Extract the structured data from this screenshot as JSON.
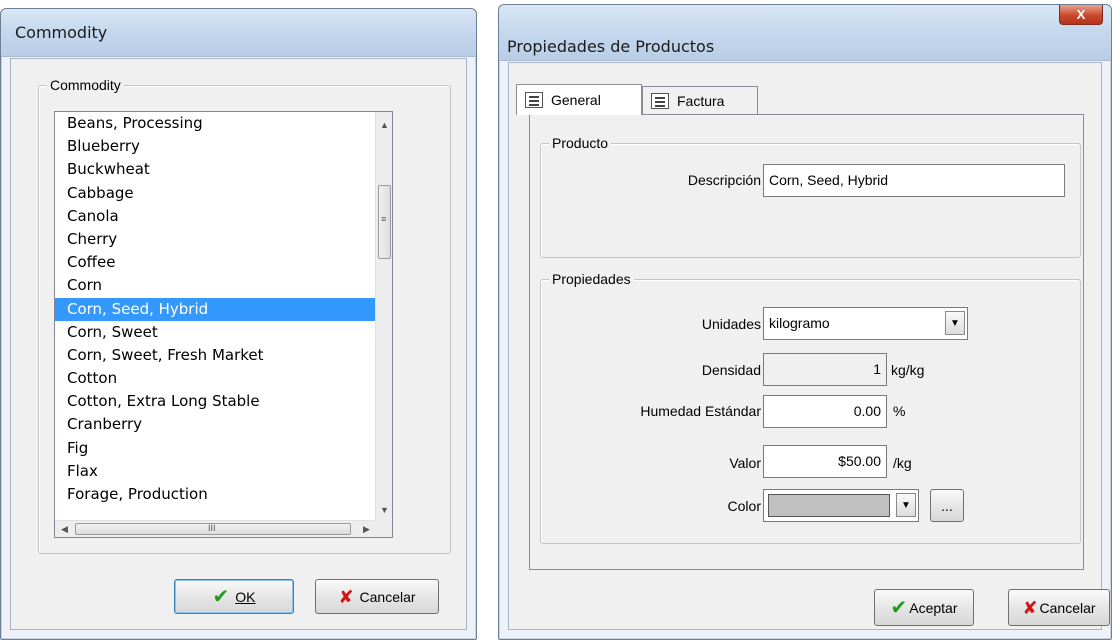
{
  "commodity_dialog": {
    "title": "Commodity",
    "group_label": "Commodity",
    "items": [
      "Beans, Processing",
      "Blueberry",
      "Buckwheat",
      "Cabbage",
      "Canola",
      "Cherry",
      "Coffee",
      "Corn",
      "Corn, Seed, Hybrid",
      "Corn, Sweet",
      "Corn, Sweet, Fresh Market",
      "Cotton",
      "Cotton, Extra Long Stable",
      "Cranberry",
      "Fig",
      "Flax",
      "Forage, Production"
    ],
    "selected_item": "Corn, Seed, Hybrid",
    "ok_label": "OK",
    "cancel_label": "Cancelar"
  },
  "product_dialog": {
    "title": "Propiedades de Productos",
    "close_label": "X",
    "tabs": [
      {
        "label": "General",
        "icon": "properties-icon",
        "active": true
      },
      {
        "label": "Factura",
        "icon": "invoice-icon",
        "active": false
      }
    ],
    "producto_group": {
      "label": "Producto",
      "descripcion_label": "Descripción",
      "descripcion_value": "Corn, Seed, Hybrid"
    },
    "propiedades_group": {
      "label": "Propiedades",
      "unidades_label": "Unidades",
      "unidades_value": "kilogramo",
      "densidad_label": "Densidad",
      "densidad_value": "1",
      "densidad_unit": "kg/kg",
      "humedad_label": "Humedad Estándar",
      "humedad_value": "0.00",
      "humedad_unit": "%",
      "valor_label": "Valor",
      "valor_value": "$50.00",
      "valor_unit": "/kg",
      "color_label": "Color",
      "color_value": "#c0c0c0",
      "color_more_label": "..."
    },
    "aceptar_label": "Aceptar",
    "cancelar_label": "Cancelar"
  }
}
